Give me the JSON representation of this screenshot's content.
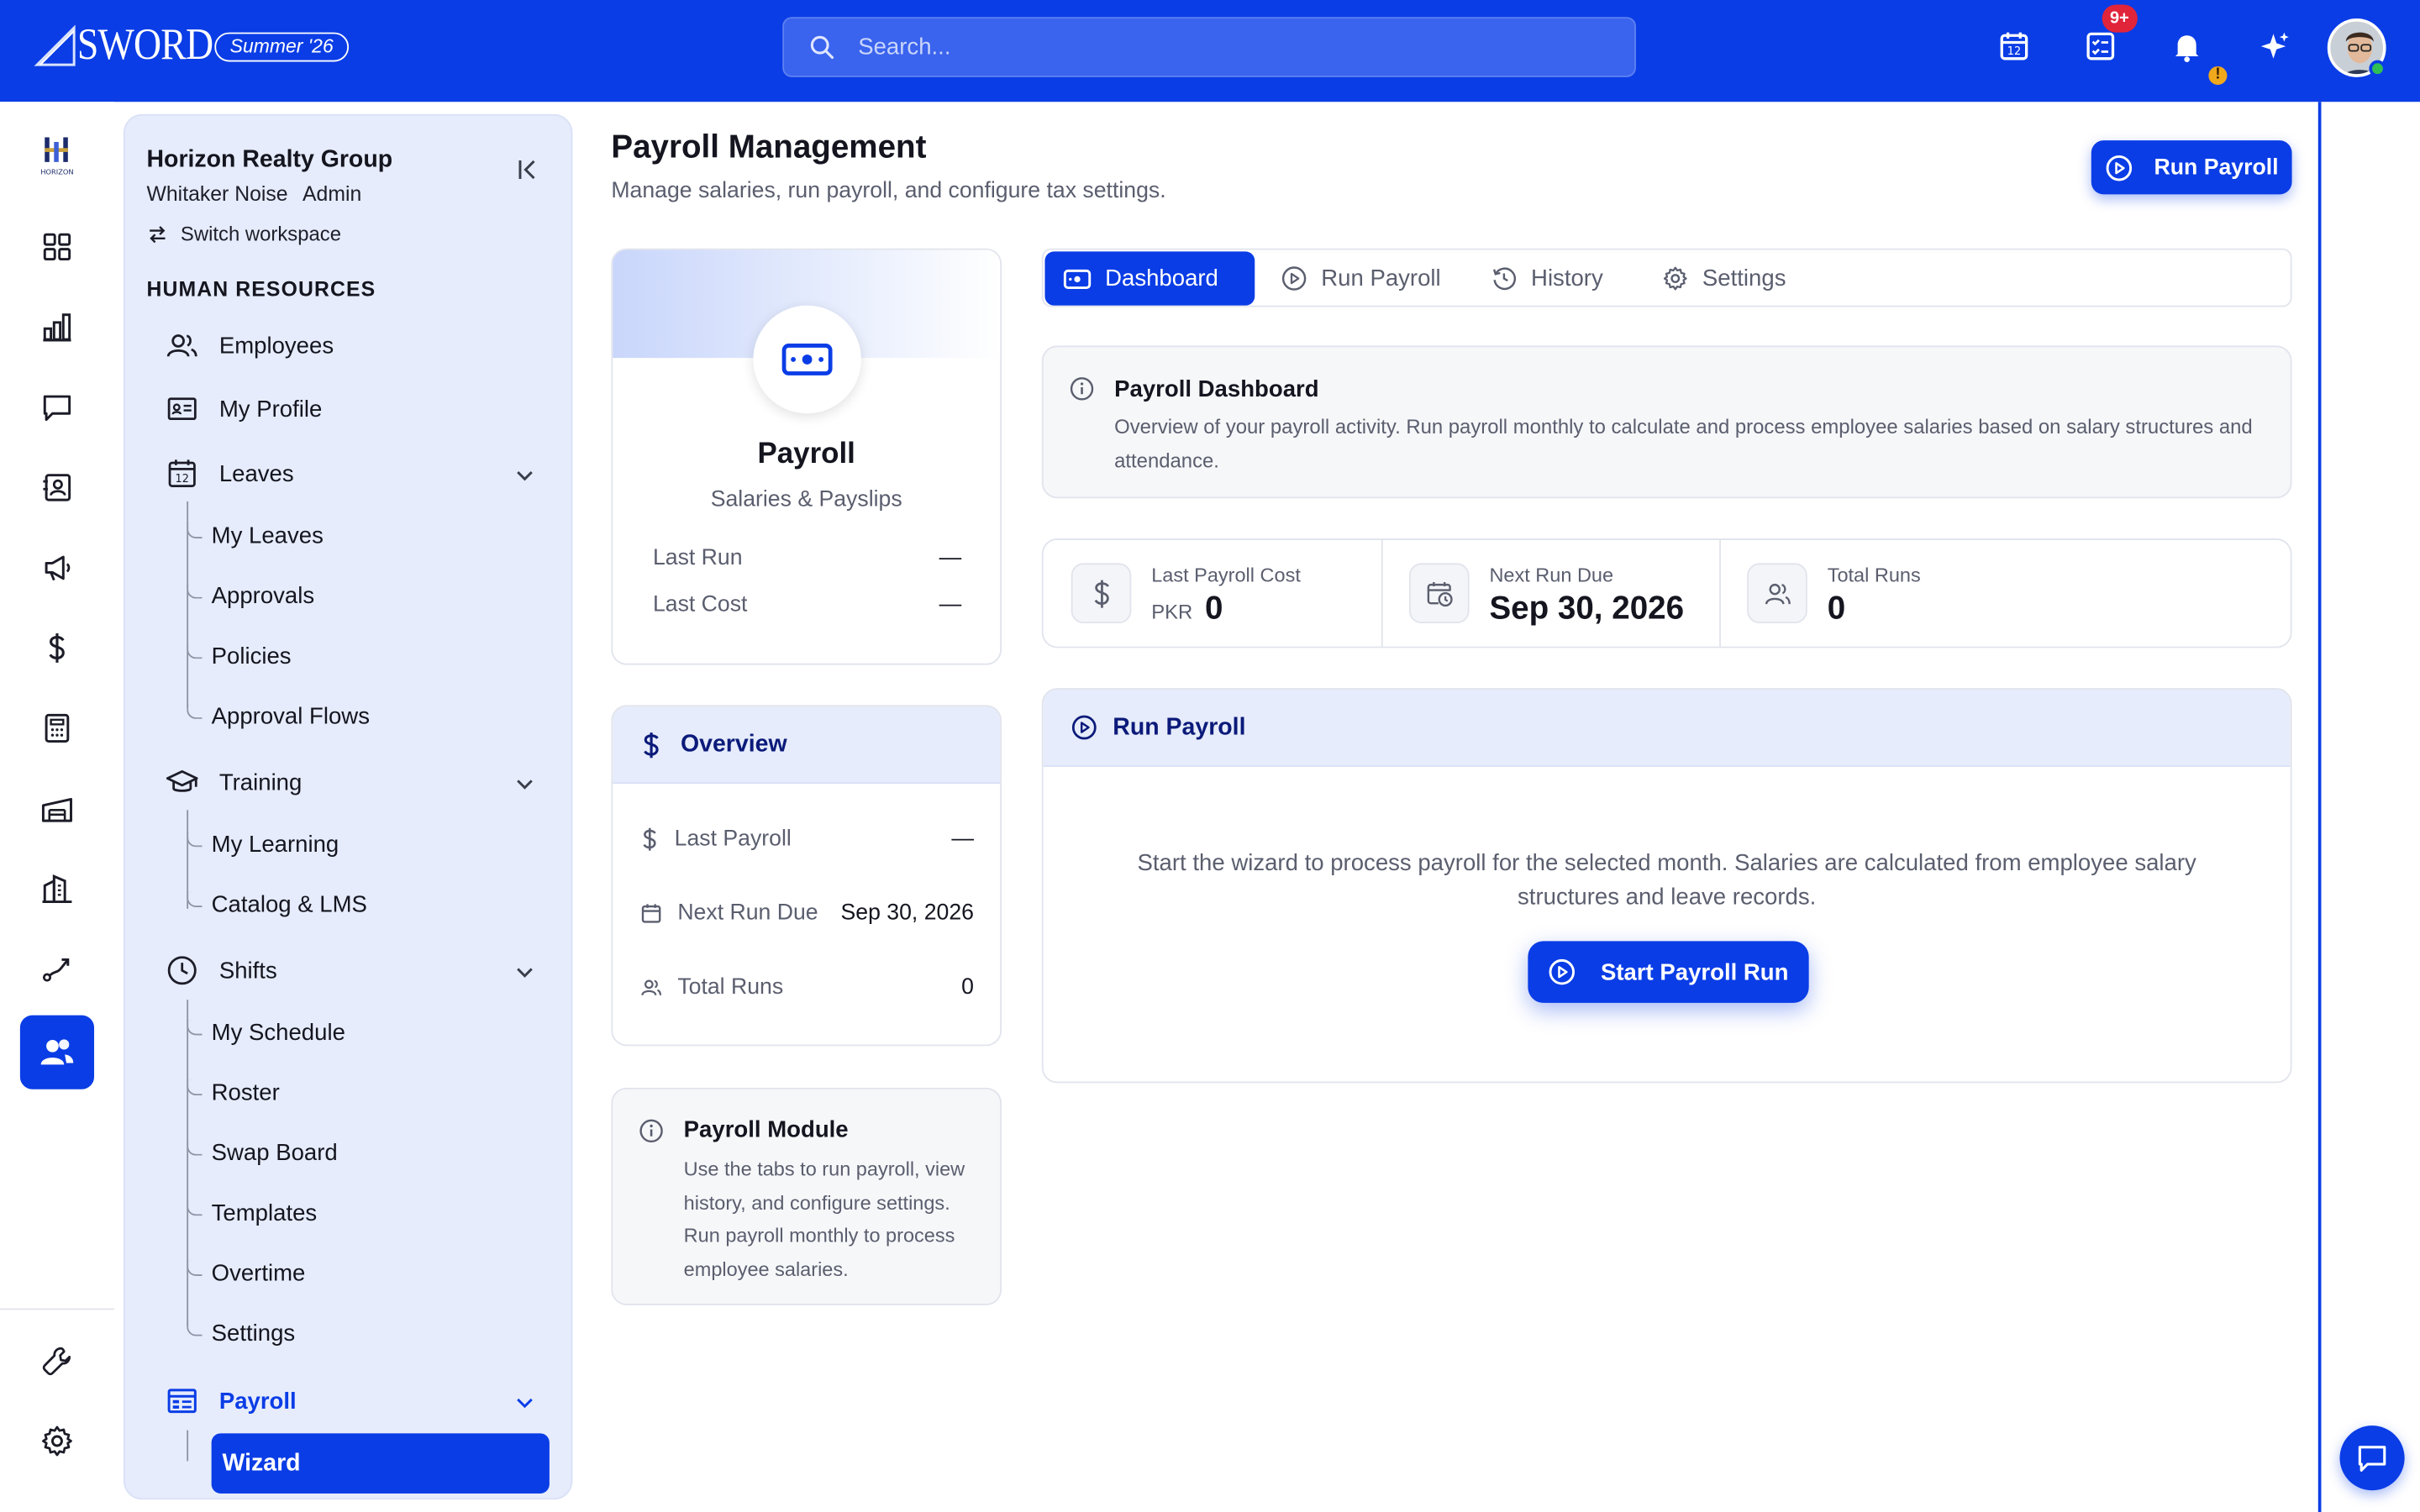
{
  "brand": {
    "name": "SWORD",
    "season": "Summer '26"
  },
  "search": {
    "placeholder": "Search..."
  },
  "header": {
    "notification_count": "9+",
    "warning_glyph": "!"
  },
  "rail": {
    "icons": [
      "dashboard-grid-icon",
      "bar-chart-icon",
      "message-icon",
      "contact-book-icon",
      "megaphone-icon",
      "dollar-icon",
      "calculator-icon",
      "warehouse-icon",
      "building-icon",
      "route-icon",
      "people-icon",
      "wrench-icon",
      "settings-icon"
    ],
    "active": "people-icon"
  },
  "sidebar": {
    "org_name": "Horizon Realty Group",
    "user_name": "Whitaker Noise",
    "user_role": "Admin",
    "switch_label": "Switch workspace",
    "section_title": "HUMAN RESOURCES",
    "items": {
      "employees": "Employees",
      "my_profile": "My Profile",
      "leaves": "Leaves",
      "leaves_children": [
        "My Leaves",
        "Approvals",
        "Policies",
        "Approval Flows"
      ],
      "training": "Training",
      "training_children": [
        "My Learning",
        "Catalog & LMS"
      ],
      "shifts": "Shifts",
      "shifts_children": [
        "My Schedule",
        "Roster",
        "Swap Board",
        "Templates",
        "Overtime",
        "Settings"
      ],
      "payroll": "Payroll",
      "payroll_children": [
        "Wizard"
      ]
    }
  },
  "page": {
    "title": "Payroll Management",
    "subtitle": "Manage salaries, run payroll, and configure tax settings.",
    "primary_action": "Run Payroll"
  },
  "payroll_card": {
    "title": "Payroll",
    "subtitle": "Salaries & Payslips",
    "rows": [
      {
        "label": "Last Run",
        "value": "—"
      },
      {
        "label": "Last Cost",
        "value": "—"
      }
    ]
  },
  "overview": {
    "title": "Overview",
    "rows": [
      {
        "label": "Last Payroll",
        "value": "—"
      },
      {
        "label": "Next Run Due",
        "value": "Sep 30, 2026"
      },
      {
        "label": "Total Runs",
        "value": "0"
      }
    ]
  },
  "module_info": {
    "title": "Payroll Module",
    "text": "Use the tabs to run payroll, view history, and configure settings. Run payroll monthly to process employee salaries."
  },
  "tabs": [
    {
      "label": "Dashboard",
      "active": true
    },
    {
      "label": "Run Payroll",
      "active": false
    },
    {
      "label": "History",
      "active": false
    },
    {
      "label": "Settings",
      "active": false
    }
  ],
  "dashboard_info": {
    "title": "Payroll Dashboard",
    "text": "Overview of your payroll activity. Run payroll monthly to calculate and process employee salaries based on salary structures and attendance."
  },
  "stats": [
    {
      "label": "Last Payroll Cost",
      "prefix": "PKR",
      "value": "0"
    },
    {
      "label": "Next Run Due",
      "value": "Sep 30, 2026"
    },
    {
      "label": "Total Runs",
      "value": "0"
    }
  ],
  "run_panel": {
    "title": "Run Payroll",
    "text": "Start the wizard to process payroll for the selected month. Salaries are calculated from employee salary structures and leave records.",
    "button": "Start Payroll Run"
  },
  "colors": {
    "primary": "#0a3de6",
    "soft": "#e6ecfb",
    "badge": "#e0243a",
    "online": "#2fbf55"
  }
}
